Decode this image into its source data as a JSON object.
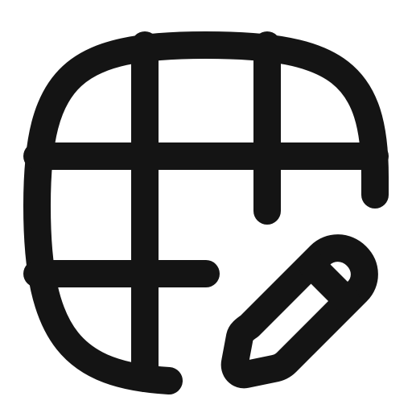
{
  "icon": {
    "name": "table-edit-icon",
    "stroke_color": "#141414",
    "background_color": "#ffffff"
  }
}
